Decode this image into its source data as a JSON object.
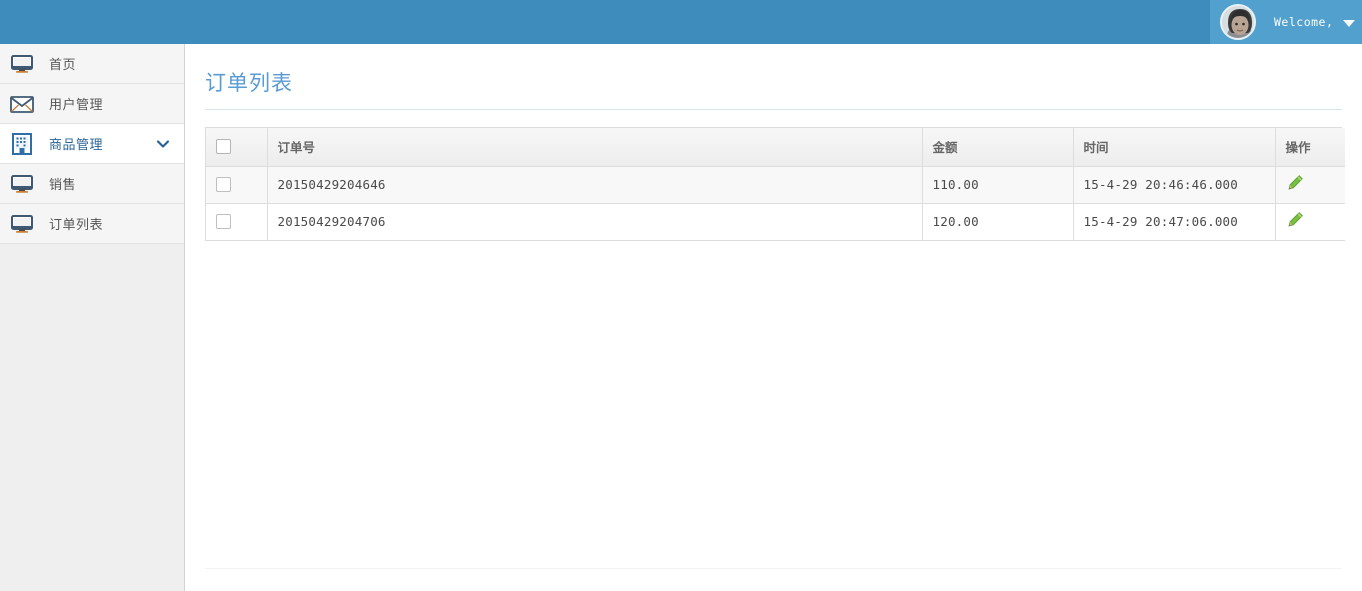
{
  "header": {
    "welcome_text": "Welcome,",
    "avatar_name": "user-avatar",
    "caret_icon": "caret-down-icon",
    "bar_color": "#3e8cbc",
    "panel_color": "#52a0cd"
  },
  "sidebar": {
    "items": [
      {
        "label": "首页",
        "icon": "monitor-icon",
        "active": false,
        "has_chevron": false
      },
      {
        "label": "用户管理",
        "icon": "envelope-icon",
        "active": false,
        "has_chevron": false
      },
      {
        "label": "商品管理",
        "icon": "building-icon",
        "active": true,
        "has_chevron": true
      },
      {
        "label": "销售",
        "icon": "monitor-icon",
        "active": false,
        "has_chevron": false
      },
      {
        "label": "订单列表",
        "icon": "monitor-icon",
        "active": false,
        "has_chevron": false
      }
    ],
    "active_color": "#2a6496"
  },
  "main": {
    "page_title": "订单列表",
    "title_color": "#5b9bd5",
    "table": {
      "columns": [
        "",
        "订单号",
        "金额",
        "时间",
        "操作"
      ],
      "rows": [
        {
          "order_no": "20150429204646",
          "amount": "110.00",
          "time": "15-4-29 20:46:46.000",
          "action_icon": "pencil-edit-icon"
        },
        {
          "order_no": "20150429204706",
          "amount": "120.00",
          "time": "15-4-29 20:47:06.000",
          "action_icon": "pencil-edit-icon"
        }
      ]
    }
  }
}
